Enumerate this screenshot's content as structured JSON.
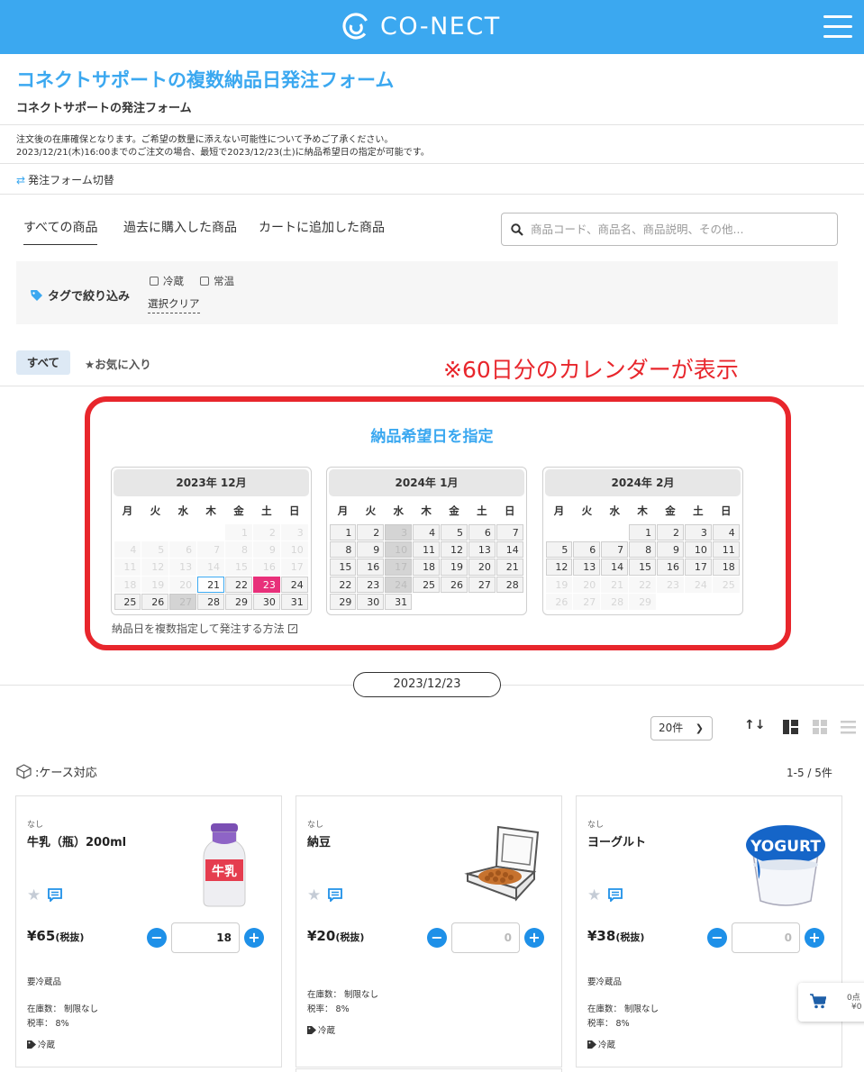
{
  "header": {
    "brand": "CO-NECT",
    "brand_color": "#3ba8f0"
  },
  "page": {
    "title": "コネクトサポートの複数納品日発注フォーム",
    "subtitle": "コネクトサポートの発注フォーム",
    "notice_line1": "注文後の在庫確保となります。ご希望の数量に添えない可能性について予めご了承ください。",
    "notice_line2": "2023/12/21(木)16:00までのご注文の場合、最短で2023/12/23(土)に納品希望日の指定が可能です。",
    "switch_label": "発注フォーム切替"
  },
  "tabs": [
    {
      "label": "すべての商品",
      "active": true
    },
    {
      "label": "過去に購入した商品",
      "active": false
    },
    {
      "label": "カートに追加した商品",
      "active": false
    }
  ],
  "search": {
    "placeholder": "商品コード、商品名、商品説明、その他..."
  },
  "filter": {
    "label": "タグで絞り込み",
    "options": [
      "冷蔵",
      "常温"
    ],
    "clear_label": "選択クリア"
  },
  "list_tabs": {
    "all": "すべて",
    "favorites": "★お気に入り"
  },
  "annotation": "※60日分のカレンダーが表示",
  "calendar": {
    "title": "納品希望日を指定",
    "weekdays": [
      "月",
      "火",
      "水",
      "木",
      "金",
      "土",
      "日"
    ],
    "months": [
      {
        "label": "2023年 12月",
        "offset": 4,
        "days": 31,
        "available_from": 21,
        "available_to": 31,
        "today": 21,
        "selected": [
          23
        ],
        "closed": [
          27
        ]
      },
      {
        "label": "2024年 1月",
        "offset": 0,
        "days": 31,
        "available_from": 1,
        "available_to": 31,
        "today": null,
        "selected": [],
        "closed": [
          3,
          10,
          17,
          24
        ]
      },
      {
        "label": "2024年 2月",
        "offset": 3,
        "days": 29,
        "available_from": 1,
        "available_to": 18,
        "today": null,
        "selected": [],
        "closed": []
      }
    ],
    "help_link": "納品日を複数指定して発注する方法",
    "selected_date": "2023/12/23"
  },
  "toolbar": {
    "per_page": "20件",
    "sort_icon": "↑↓"
  },
  "list_info": {
    "case_note": ":ケース対応",
    "count": "1-5 / 5件"
  },
  "products": [
    {
      "maker": "なし",
      "name": "牛乳（瓶）200ml",
      "price": "¥65",
      "tax": "(税抜)",
      "qty": "18",
      "extra": "要冷蔵品",
      "stock": "在庫数： 制限なし",
      "tax_rate": "税率： 8%",
      "tag": "冷蔵",
      "icon": "milk-bottle"
    },
    {
      "maker": "なし",
      "name": "納豆",
      "price": "¥20",
      "tax": "(税抜)",
      "qty": "0",
      "extra": "",
      "stock": "在庫数： 制限なし",
      "tax_rate": "税率： 8%",
      "tag": "冷蔵",
      "icon": "natto-pack"
    },
    {
      "maker": "なし",
      "name": "ヨーグルト",
      "price": "¥38",
      "tax": "(税抜)",
      "qty": "0",
      "extra": "要冷蔵品",
      "stock": "在庫数： 制限なし",
      "tax_rate": "税率： 8%",
      "tag": "冷蔵",
      "icon": "yogurt-cup"
    }
  ],
  "product_image_labels": {
    "milk": "牛乳",
    "yogurt": "YOGURT"
  },
  "cart": {
    "count": "0点",
    "amount": "¥0"
  }
}
